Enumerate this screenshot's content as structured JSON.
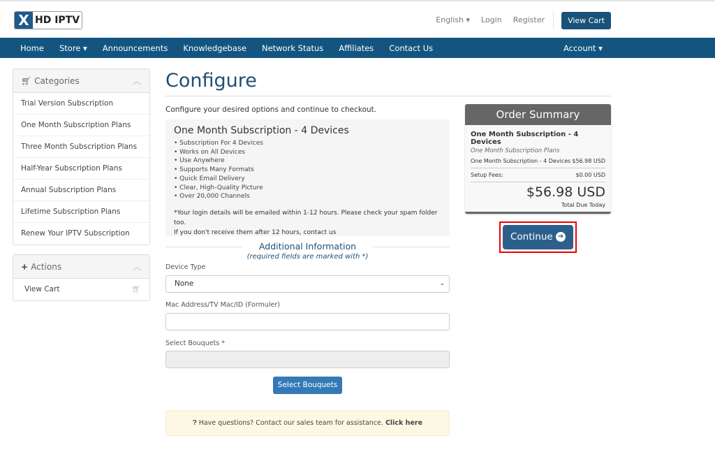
{
  "brand": {
    "logo_text": "HD IPTV",
    "logo_mark": "X"
  },
  "toplinks": {
    "language": "English ▾",
    "login": "Login",
    "register": "Register",
    "view_cart": "View Cart"
  },
  "nav": {
    "items": [
      "Home",
      "Store ▾",
      "Announcements",
      "Knowledgebase",
      "Network Status",
      "Affiliates",
      "Contact Us"
    ],
    "account": "Account ▾"
  },
  "categories": {
    "title": "Categories",
    "items": [
      "Trial Version Subscription",
      "One Month Subscription Plans",
      "Three Month Subscription Plans",
      "Half-Year Subscription Plans",
      "Annual Subscription Plans",
      "Lifetime Subscription Plans",
      "Renew Your IPTV Subscription"
    ]
  },
  "actions": {
    "title": "Actions",
    "items": [
      "View Cart"
    ]
  },
  "page": {
    "title": "Configure",
    "intro": "Configure your desired options and continue to checkout."
  },
  "product": {
    "name": "One Month Subscription - 4 Devices",
    "features": [
      "• Subscription For 4 Devices",
      "• Works on All Devices",
      "• Use Anywhere",
      "• Supports Many Formats",
      "• Quick Email Delivery",
      "• Clear, High-Quality Picture",
      "• Over 20,000 Channels"
    ],
    "note1": "*Your login details will be emailed within 1-12 hours. Please check your spam folder too.",
    "note2": "If you don't receive them after 12 hours, contact us"
  },
  "additional": {
    "title": "Additional Information",
    "subtitle": "(required fields are marked with *)"
  },
  "form": {
    "device_label": "Device Type",
    "device_value": "None",
    "mac_label": "Mac Address/TV Mac/ID (Formuler)",
    "mac_value": "",
    "bouquets_label": "Select Bouquets *",
    "bouquets_value": "",
    "select_bouquets_button": "Select Bouquets"
  },
  "help": {
    "text": "Have questions? Contact our sales team for assistance.",
    "link": "Click here"
  },
  "summary": {
    "title": "Order Summary",
    "product": "One Month Subscription - 4 Devices",
    "category": "One Month Subscription Plans",
    "line_label": "One Month Subscription - 4 Devices",
    "line_price": "$56.98 USD",
    "setup_label": "Setup Fees:",
    "setup_price": "$0.00 USD",
    "total": "$56.98 USD",
    "total_label": "Total Due Today"
  },
  "continue": "Continue"
}
